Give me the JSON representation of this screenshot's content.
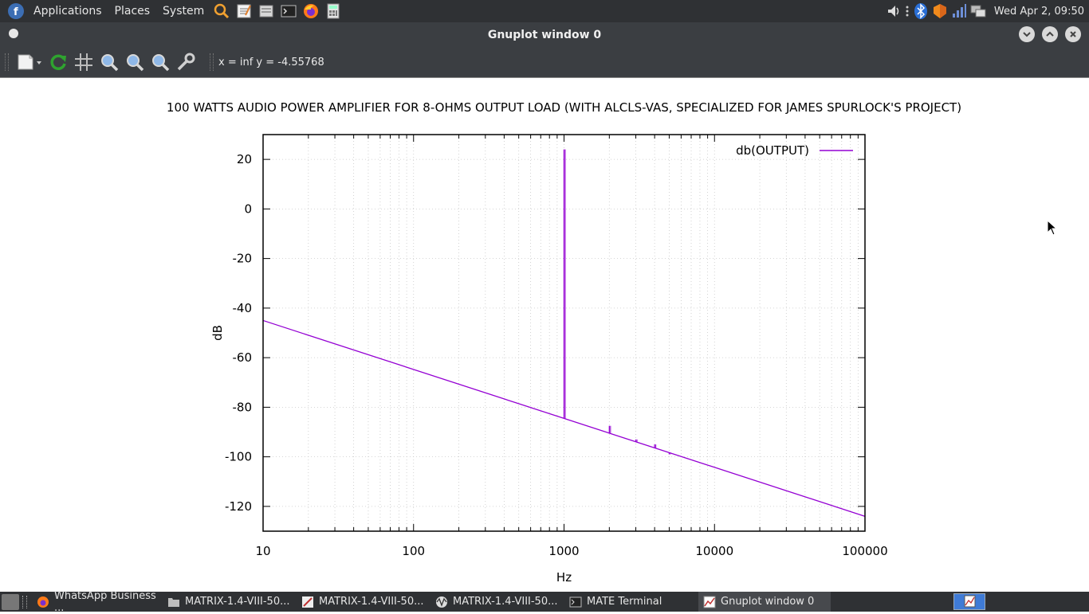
{
  "top_panel": {
    "menus": [
      "Applications",
      "Places",
      "System"
    ],
    "clock": "Wed Apr  2, 09:50"
  },
  "window": {
    "title": "Gnuplot window 0"
  },
  "toolbar": {
    "coords": "x = inf y = -4.55768"
  },
  "taskbar": {
    "tasks": [
      {
        "label": "WhatsApp Business ...",
        "icon": "firefox-icon"
      },
      {
        "label": "MATRIX-1.4-VIII-50...",
        "icon": "folder-icon"
      },
      {
        "label": "MATRIX-1.4-VIII-50...",
        "icon": "editor-icon"
      },
      {
        "label": "MATRIX-1.4-VIII-50...",
        "icon": "wave-icon"
      },
      {
        "label": "MATE Terminal",
        "icon": "terminal-icon"
      },
      {
        "label": "Gnuplot window 0",
        "icon": "gnuplot-icon"
      }
    ]
  },
  "chart_data": {
    "type": "line",
    "title": "100 WATTS AUDIO POWER AMPLIFIER FOR 8-OHMS OUTPUT LOAD (WITH ALCLS-VAS, SPECIALIZED FOR JAMES SPURLOCK'S PROJECT)",
    "xlabel": "Hz",
    "ylabel": "dB",
    "xscale": "log",
    "xlim": [
      10,
      100000
    ],
    "ylim": [
      -130,
      30
    ],
    "xticks": [
      "10",
      "100",
      "1000",
      "10000",
      "100000"
    ],
    "yticks": [
      "20",
      "0",
      "-20",
      "-40",
      "-60",
      "-80",
      "-100",
      "-120"
    ],
    "grid": true,
    "legend": "top-right",
    "series": [
      {
        "name": "db(OUTPUT)",
        "color": "#9400d3",
        "points": [
          [
            10,
            -45
          ],
          [
            1000,
            -84.5
          ],
          [
            100000,
            -124
          ]
        ],
        "spikes": [
          [
            1000,
            24
          ],
          [
            2000,
            -87.5
          ],
          [
            3000,
            -93
          ],
          [
            4000,
            -95
          ],
          [
            5000,
            -99
          ]
        ]
      }
    ]
  }
}
